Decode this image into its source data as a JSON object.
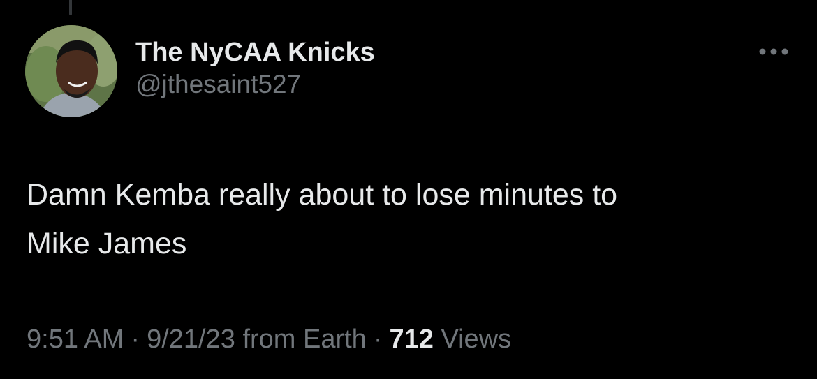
{
  "tweet": {
    "author": {
      "display_name": "The NyCAA Knicks",
      "handle": "@jthesaint527"
    },
    "text_line_1": "Damn Kemba really about to lose minutes to",
    "text_line_2": "Mike James",
    "time": "9:51 AM",
    "date": "9/21/23",
    "source": "from Earth",
    "separator": "·",
    "views_count": "712",
    "views_label": "Views"
  },
  "icons": {
    "more": "more-horizontal-icon",
    "avatar": "profile-photo"
  },
  "colors": {
    "background": "#000000",
    "primary_text": "#e7e9ea",
    "secondary_text": "#71767b"
  }
}
